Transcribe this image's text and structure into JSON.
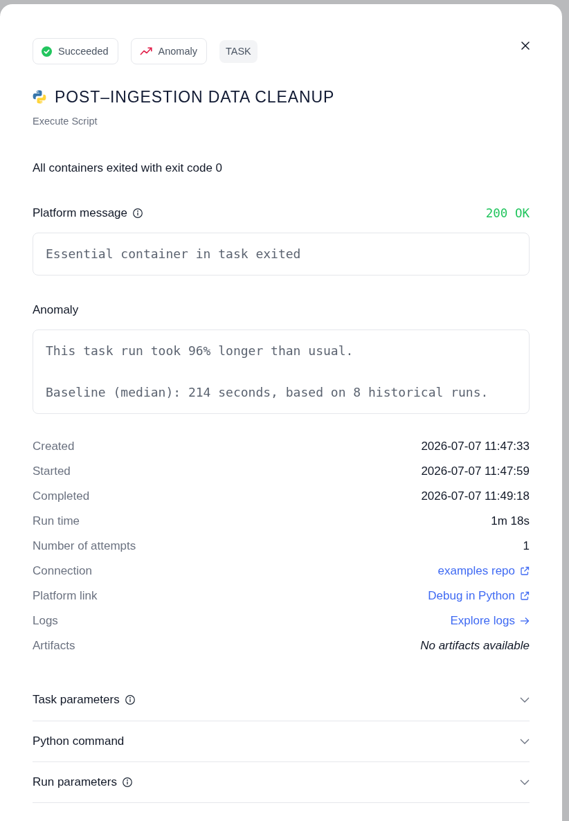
{
  "badges": [
    {
      "kind": "status",
      "label": "Succeeded"
    },
    {
      "kind": "anomaly",
      "label": "Anomaly"
    },
    {
      "kind": "type",
      "label": "TASK"
    }
  ],
  "title": "POST–INGESTION DATA CLEANUP",
  "subtitle": "Execute Script",
  "summary": "All containers exited with exit code 0",
  "platform_message": {
    "label": "Platform message",
    "status": "200 OK",
    "message": "Essential container in task exited"
  },
  "anomaly": {
    "label": "Anomaly",
    "lines": [
      "This task run took 96% longer than usual.",
      "Baseline (median): 214 seconds, based on 8 historical runs."
    ]
  },
  "details": [
    {
      "label": "Created",
      "value": "2026-07-07 11:47:33",
      "kind": "text"
    },
    {
      "label": "Started",
      "value": "2026-07-07 11:47:59",
      "kind": "text"
    },
    {
      "label": "Completed",
      "value": "2026-07-07 11:49:18",
      "kind": "text"
    },
    {
      "label": "Run time",
      "value": "1m 18s",
      "kind": "text"
    },
    {
      "label": "Number of attempts",
      "value": "1",
      "kind": "text"
    },
    {
      "label": "Connection",
      "value": "examples repo",
      "kind": "external_link"
    },
    {
      "label": "Platform link",
      "value": "Debug in Python",
      "kind": "external_link"
    },
    {
      "label": "Logs",
      "value": "Explore logs",
      "kind": "internal_link"
    },
    {
      "label": "Artifacts",
      "value": "No artifacts available",
      "kind": "empty"
    }
  ],
  "sections": [
    {
      "label": "Task parameters",
      "info": true,
      "expanded": false
    },
    {
      "label": "Python command",
      "info": false,
      "expanded": false
    },
    {
      "label": "Run parameters",
      "info": true,
      "expanded": false
    }
  ]
}
